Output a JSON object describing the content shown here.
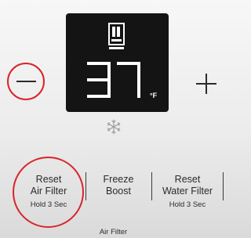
{
  "display": {
    "temperature": "37",
    "unit": "°F",
    "mode_icon": "refrigerator-icon"
  },
  "controls": {
    "decrease_icon": "minus-icon",
    "increase_icon": "plus-icon",
    "indicator_icon": "snowflake-icon"
  },
  "buttons": [
    {
      "line1": "Reset",
      "line2": "Air Filter",
      "hold": "Hold 3 Sec"
    },
    {
      "line1": "Freeze",
      "line2": "Boost",
      "hold": ""
    },
    {
      "line1": "Reset",
      "line2": "Water Filter",
      "hold": "Hold 3 Sec"
    }
  ],
  "footer": {
    "label": "Air Filter"
  },
  "colors": {
    "highlight": "#d8242b",
    "display_bg": "#141414",
    "text": "#2b2b2b"
  }
}
